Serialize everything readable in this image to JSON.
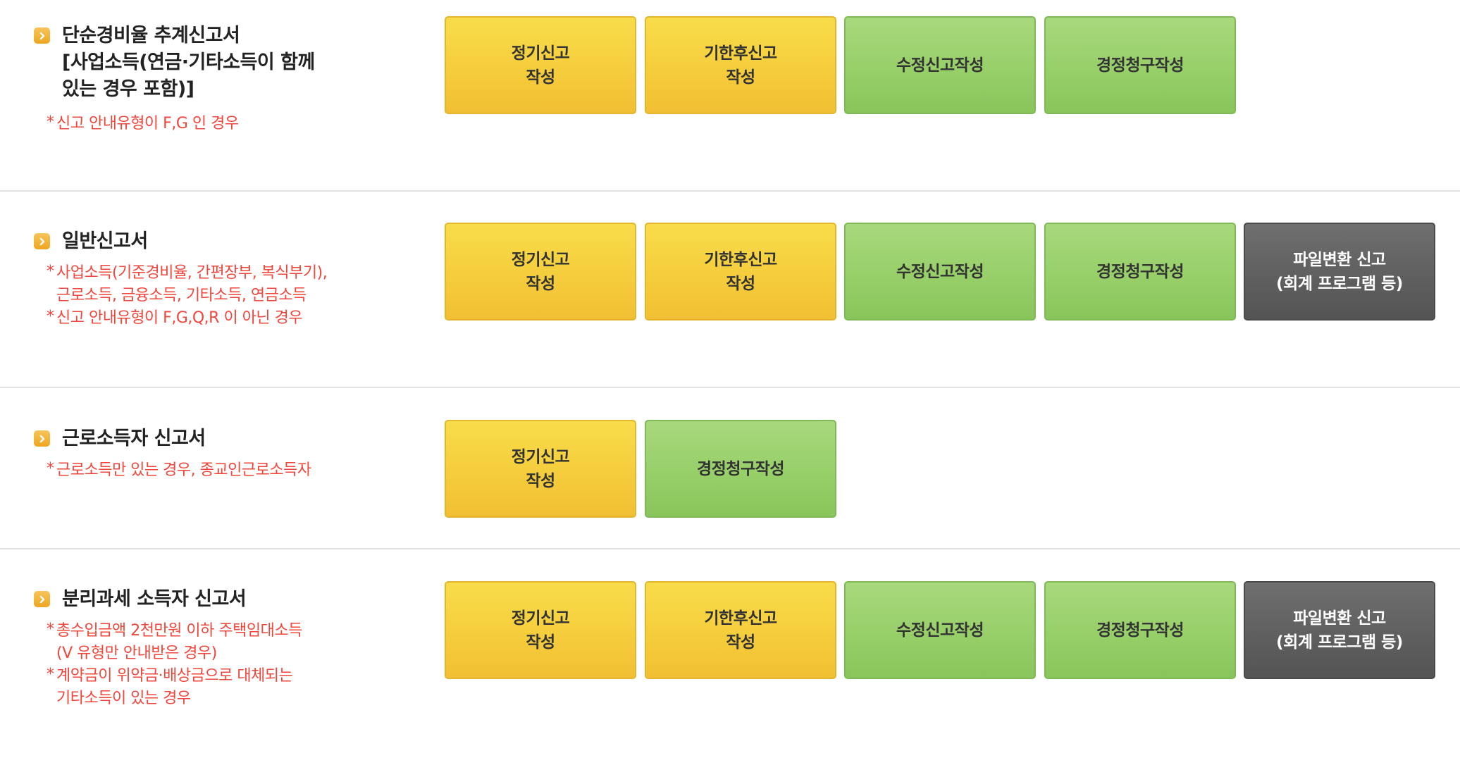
{
  "sections": [
    {
      "title": "단순경비율 추계신고서\n[사업소득(연금·기타소득이 함께\n있는 경우 포함)]",
      "notes": [
        "신고 안내유형이 F,G 인 경우"
      ],
      "buttons": [
        {
          "label": "정기신고\n작성",
          "color": "yellow"
        },
        {
          "label": "기한후신고\n작성",
          "color": "yellow"
        },
        {
          "label": "수정신고작성",
          "color": "green"
        },
        {
          "label": "경정청구작성",
          "color": "green"
        }
      ]
    },
    {
      "title": "일반신고서",
      "notes": [
        "사업소득(기준경비율, 간편장부, 복식부기),\n근로소득, 금융소득, 기타소득, 연금소득",
        "신고 안내유형이 F,G,Q,R 이 아닌 경우"
      ],
      "buttons": [
        {
          "label": "정기신고\n작성",
          "color": "yellow"
        },
        {
          "label": "기한후신고\n작성",
          "color": "yellow"
        },
        {
          "label": "수정신고작성",
          "color": "green"
        },
        {
          "label": "경정청구작성",
          "color": "green"
        },
        {
          "label": "파일변환 신고\n(회계 프로그램 등)",
          "color": "gray"
        }
      ]
    },
    {
      "title": "근로소득자 신고서",
      "notes": [
        "근로소득만 있는 경우, 종교인근로소득자"
      ],
      "buttons": [
        {
          "label": "정기신고\n작성",
          "color": "yellow"
        },
        {
          "label": "경정청구작성",
          "color": "green"
        }
      ]
    },
    {
      "title": "분리과세 소득자 신고서",
      "notes": [
        "총수입금액 2천만원 이하 주택임대소득\n(V 유형만 안내받은 경우)",
        "계약금이 위약금·배상금으로 대체되는\n기타소득이 있는 경우"
      ],
      "buttons": [
        {
          "label": "정기신고\n작성",
          "color": "yellow"
        },
        {
          "label": "기한후신고\n작성",
          "color": "yellow"
        },
        {
          "label": "수정신고작성",
          "color": "green"
        },
        {
          "label": "경정청구작성",
          "color": "green"
        },
        {
          "label": "파일변환 신고\n(회계 프로그램 등)",
          "color": "gray"
        }
      ]
    }
  ],
  "icon": "chevron-right-icon",
  "colors": {
    "note": "#f0463c",
    "yellow_button": "#f5cd3c",
    "green_button": "#97cf69",
    "gray_button": "#5e5e5e",
    "divider": "#e2e2e2"
  }
}
